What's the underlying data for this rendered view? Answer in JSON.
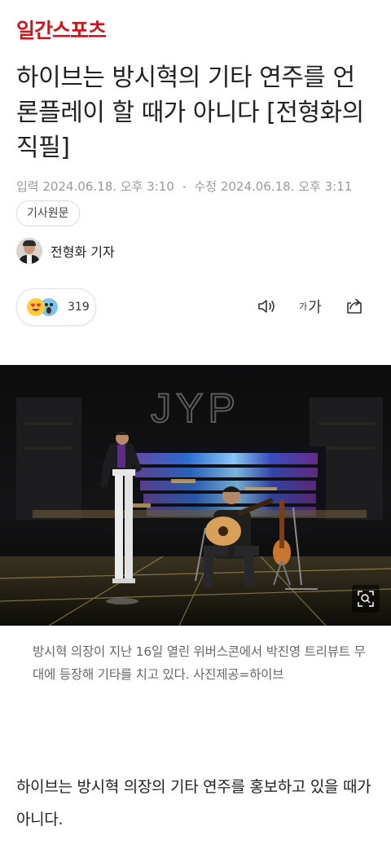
{
  "header": {
    "logo_text": "일간스포츠",
    "brand_color": "#d0141c"
  },
  "article": {
    "title": "하이브는 방시혁의 기타 연주를 언론플레이 할 때가 아니다 [전형화의 직필]",
    "published_label": "입력",
    "published_value": "2024.06.18. 오후 3:10",
    "modified_label": "수정",
    "modified_value": "2024.06.18. 오후 3:11",
    "original_button": "기사원문",
    "reporter": "전형화 기자",
    "reaction_count": "319",
    "reaction_icons": [
      "heart-eyes-emoji",
      "shocked-emoji"
    ],
    "font_size_small": "가",
    "font_size_big": "가",
    "photo_sign": "JYP",
    "photo_caption": "방시혁 의장이 지난 16일 열린 위버스콘에서 박진영 트리뷰트 무대에 등장해 기타를 치고 있다. 사진제공=하이브",
    "body_paragraph": "하이브는 방시혁 의장의 기타 연주를 홍보하고 있을 때가 아니다."
  }
}
